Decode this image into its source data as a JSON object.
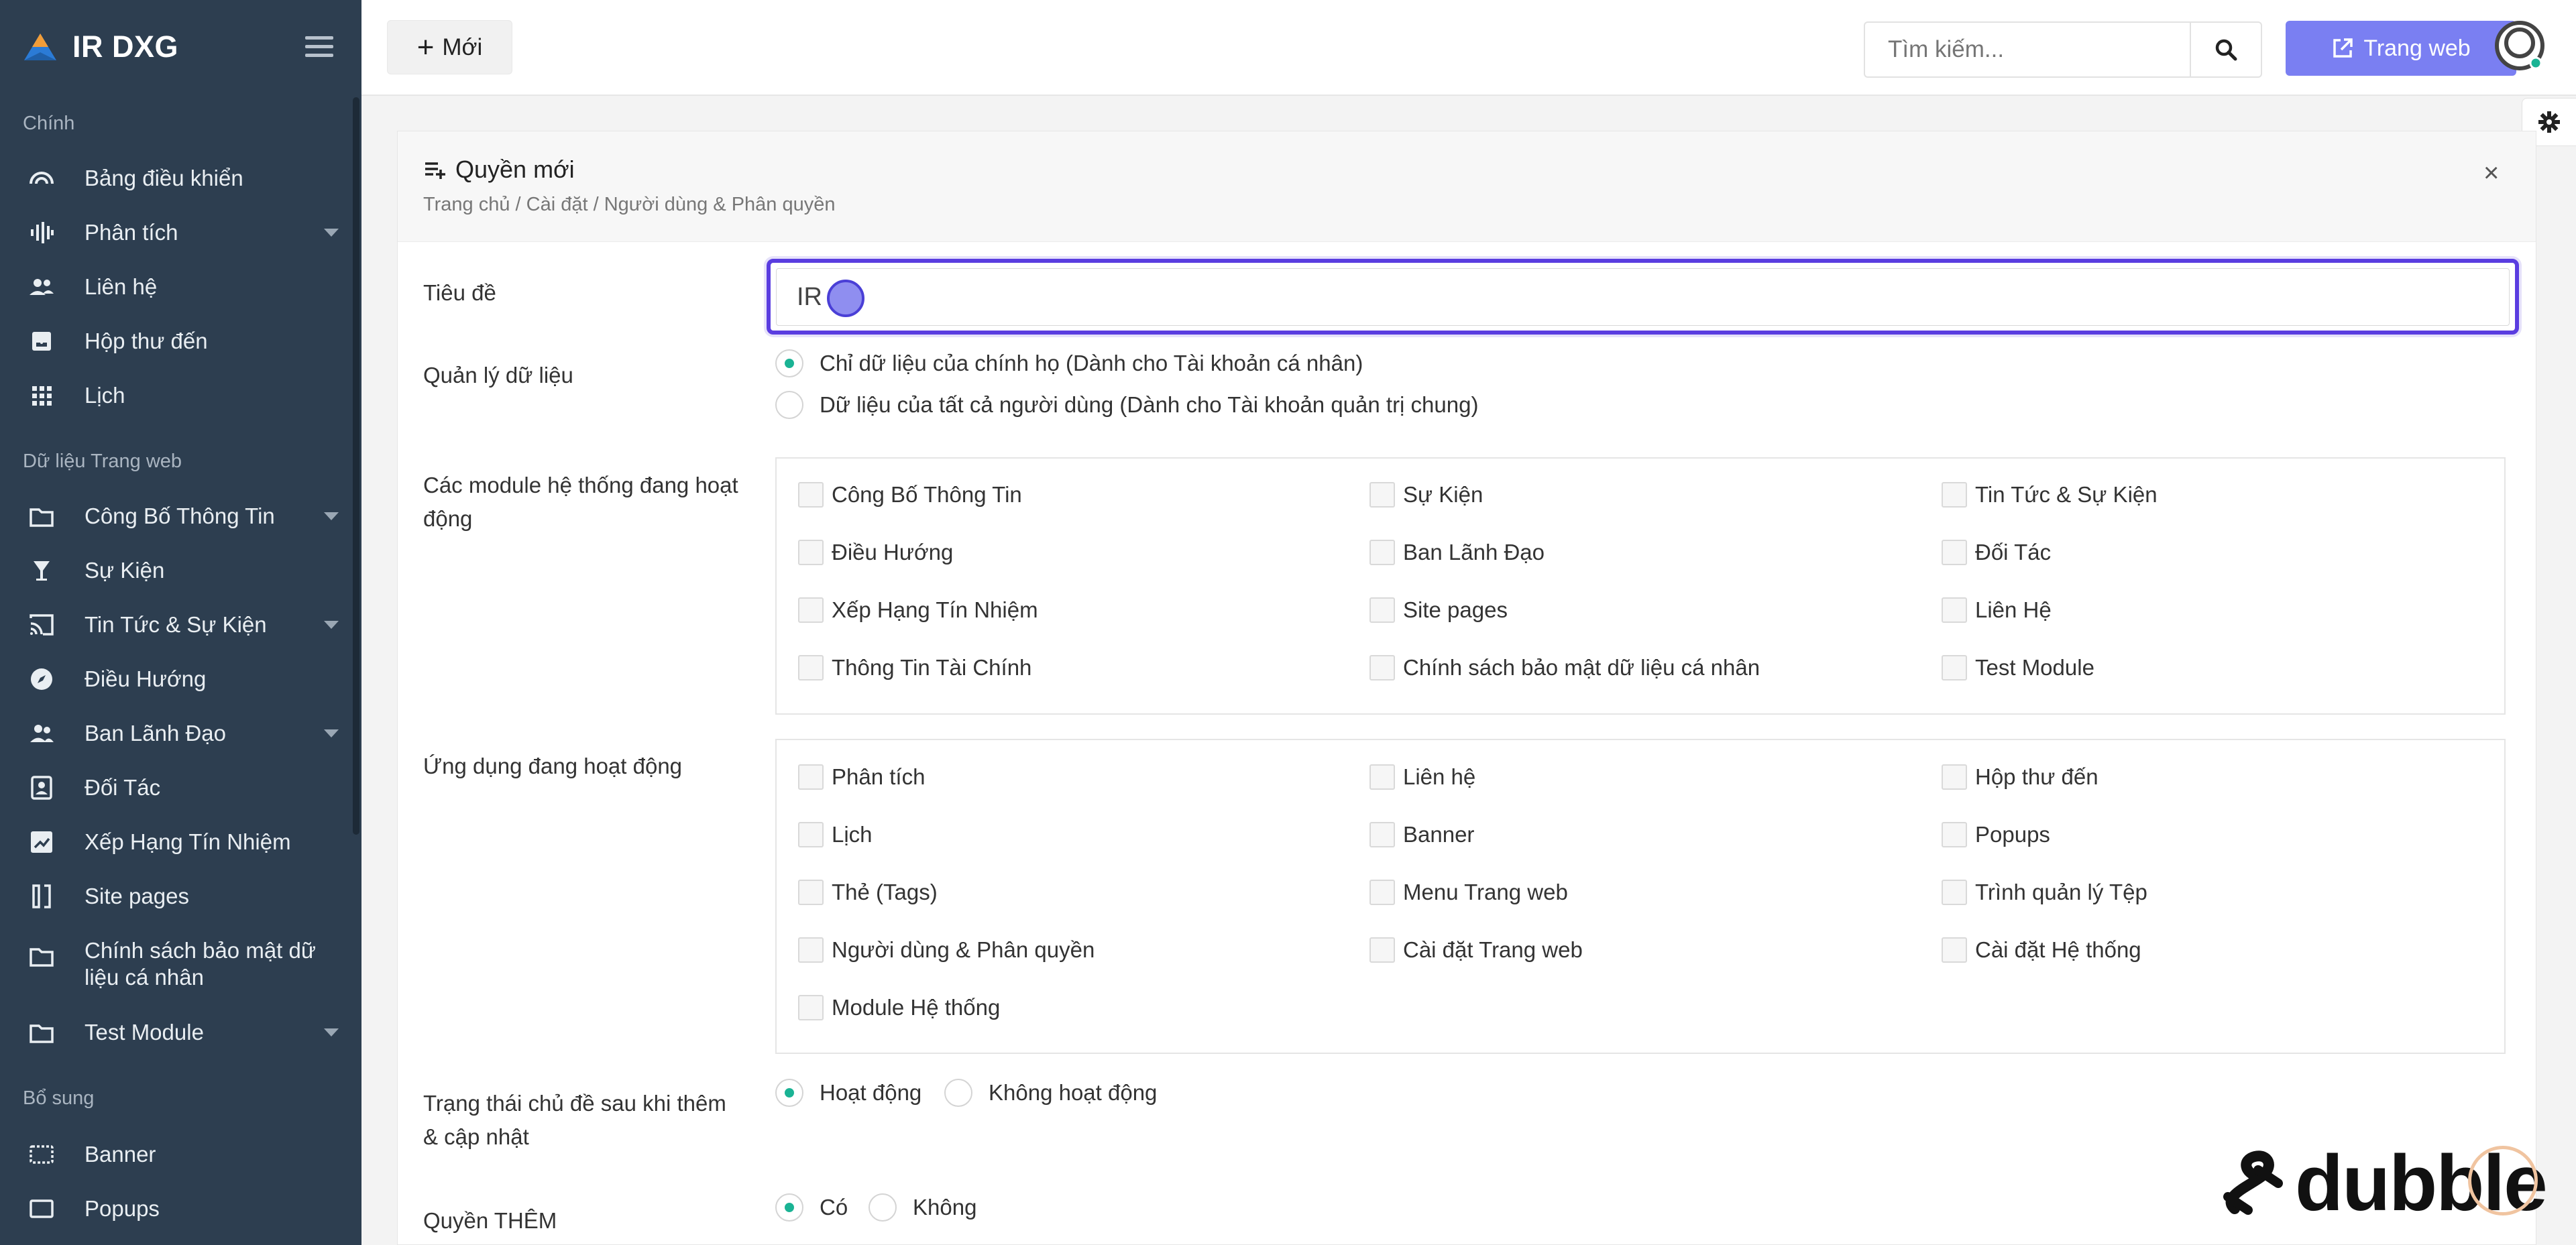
{
  "sidebar": {
    "brand": "IR DXG",
    "sections": [
      "Chính",
      "Dữ liệu Trang web",
      "Bổ sung"
    ],
    "items": [
      {
        "label": "Bảng điều khiển",
        "icon": "gauge-icon"
      },
      {
        "label": "Phân tích",
        "icon": "waveform-icon"
      },
      {
        "label": "Liên hệ",
        "icon": "users-icon"
      },
      {
        "label": "Hộp thư đến",
        "icon": "inbox-icon"
      },
      {
        "label": "Lịch",
        "icon": "apps-grid-icon"
      },
      {
        "label": "Công Bố Thông Tin",
        "icon": "folder-icon"
      },
      {
        "label": "Sự Kiện",
        "icon": "trophy-icon"
      },
      {
        "label": "Tin Tức & Sự Kiện",
        "icon": "cast-icon"
      },
      {
        "label": "Điều Hướng",
        "icon": "compass-icon"
      },
      {
        "label": "Ban Lãnh Đạo",
        "icon": "people-icon"
      },
      {
        "label": "Đối Tác",
        "icon": "contact-card-icon"
      },
      {
        "label": "Xếp Hạng Tín Nhiệm",
        "icon": "chart-edit-icon"
      },
      {
        "label": "Site pages",
        "icon": "pages-icon"
      },
      {
        "label": "Chính sách bảo mật dữ",
        "label2": "liệu cá nhân",
        "icon": "folder-icon"
      },
      {
        "label": "Test Module",
        "icon": "folder-icon"
      },
      {
        "label": "Banner",
        "icon": "banner-icon"
      },
      {
        "label": "Popups",
        "icon": "popup-icon"
      }
    ]
  },
  "topbar": {
    "new_label": "Mới",
    "search_placeholder": "Tìm kiếm...",
    "web_label": "Trang web"
  },
  "panel": {
    "title": "Quyền mới",
    "breadcrumb": "Trang chủ / Cài đặt / Người dùng & Phân quyền",
    "title_label": "Tiêu đề",
    "title_value": "IR",
    "data_label": "Quản lý dữ liệu",
    "data_options": [
      {
        "label": "Chỉ dữ liệu của chính họ (Dành cho Tài khoản cá nhân)",
        "checked": true
      },
      {
        "label": "Dữ liệu của tất cả người dùng (Dành cho Tài khoản quản trị chung)",
        "checked": false
      }
    ],
    "modules_label_1": "Các module hệ thống đang hoạt",
    "modules_label_2": "động",
    "modules": [
      "Công Bố Thông Tin",
      "Sự Kiện",
      "Tin Tức & Sự Kiện",
      "Điều Hướng",
      "Ban Lãnh Đạo",
      "Đối Tác",
      "Xếp Hạng Tín Nhiệm",
      "Site pages",
      "Liên Hệ",
      "Thông Tin Tài Chính",
      "Chính sách bảo mật dữ liệu cá nhân",
      "Test Module"
    ],
    "apps_label": "Ứng dụng đang hoạt động",
    "apps": [
      "Phân tích",
      "Liên hệ",
      "Hộp thư đến",
      "Lịch",
      "Banner",
      "Popups",
      "Thẻ (Tags)",
      "Menu Trang web",
      "Trình quản lý Tệp",
      "Người dùng & Phân quyền",
      "Cài đặt Trang web",
      "Cài đặt Hệ thống",
      "Module Hệ thống"
    ],
    "status_label_1": "Trạng thái chủ đề sau khi thêm",
    "status_label_2": "& cập nhật",
    "status_options": [
      {
        "label": "Hoạt động",
        "checked": true
      },
      {
        "label": "Không hoạt động",
        "checked": false
      }
    ],
    "add_label": "Quyền THÊM",
    "add_options": [
      {
        "label": "Có",
        "checked": true
      },
      {
        "label": "Không",
        "checked": false
      }
    ]
  },
  "watermark": "dubble",
  "colors": {
    "sidebar": "#2d3e50",
    "accent": "#7a7ff2",
    "focus": "#5a3de0",
    "radio": "#1ab394"
  }
}
